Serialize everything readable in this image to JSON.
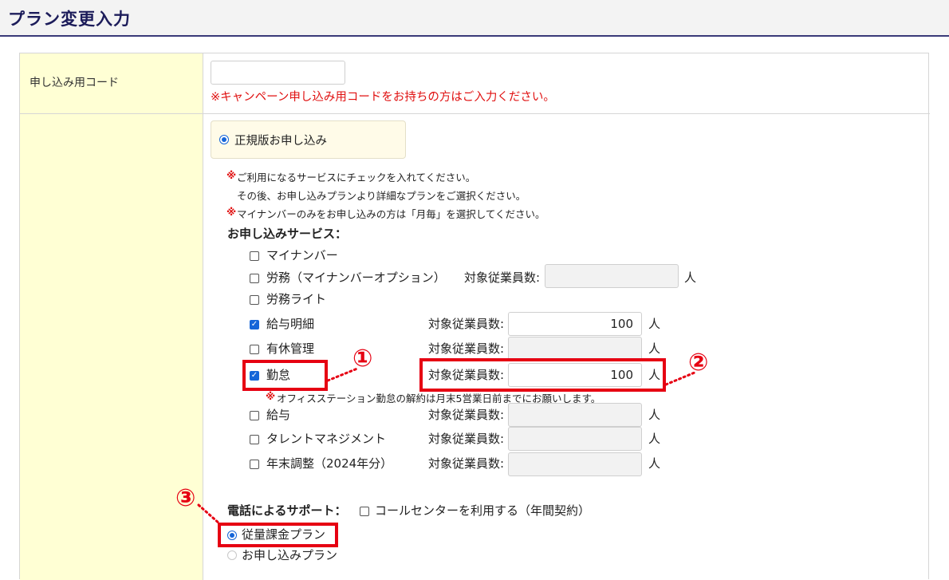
{
  "page_title": "プラン変更入力",
  "code_row": {
    "label": "申し込み用コード",
    "input_value": "",
    "note": "※キャンペーン申し込み用コードをお持ちの方はご入力ください。"
  },
  "apply_option": {
    "label": "正規版お申し込み",
    "selected": true
  },
  "notes": {
    "mark": "※",
    "line1": "ご利用になるサービスにチェックを入れてください。",
    "line2": "その後、お申し込みプランより詳細なプランをご選択ください。",
    "line3": "マイナンバーのみをお申し込みの方は「月毎」を選択してください。"
  },
  "services_heading": "お申し込みサービス：",
  "employee_label": "対象従業員数:",
  "unit": "人",
  "services": [
    {
      "name": "マイナンバー",
      "checked": false
    },
    {
      "name": "労務（マイナンバーオプション）",
      "checked": false,
      "count": ""
    },
    {
      "name": "労務ライト",
      "checked": false
    },
    {
      "name": "給与明細",
      "checked": true,
      "count": "100"
    },
    {
      "name": "有休管理",
      "checked": false,
      "count": ""
    },
    {
      "name": "勤怠",
      "checked": true,
      "count": "100"
    },
    {
      "name": "給与",
      "checked": false,
      "count": ""
    },
    {
      "name": "タレントマネジメント",
      "checked": false,
      "count": ""
    },
    {
      "name": "年末調整（2024年分）",
      "checked": false,
      "count": ""
    }
  ],
  "kintai_note": "オフィスステーション勤怠の解約は月末5営業日前までにお願いします。",
  "phone_support": {
    "label": "電話によるサポート：",
    "option": "コールセンターを利用する（年間契約）",
    "checked": false
  },
  "plans": [
    {
      "label": "従量課金プラン",
      "selected": true
    },
    {
      "label": "お申し込みプラン",
      "selected": false
    }
  ],
  "callouts": [
    "①",
    "②",
    "③"
  ],
  "colors": {
    "callout": "#e60012",
    "radio_checked": "#1565d8",
    "label_bg": "#ffffd4",
    "header_line": "#3a3a78"
  }
}
